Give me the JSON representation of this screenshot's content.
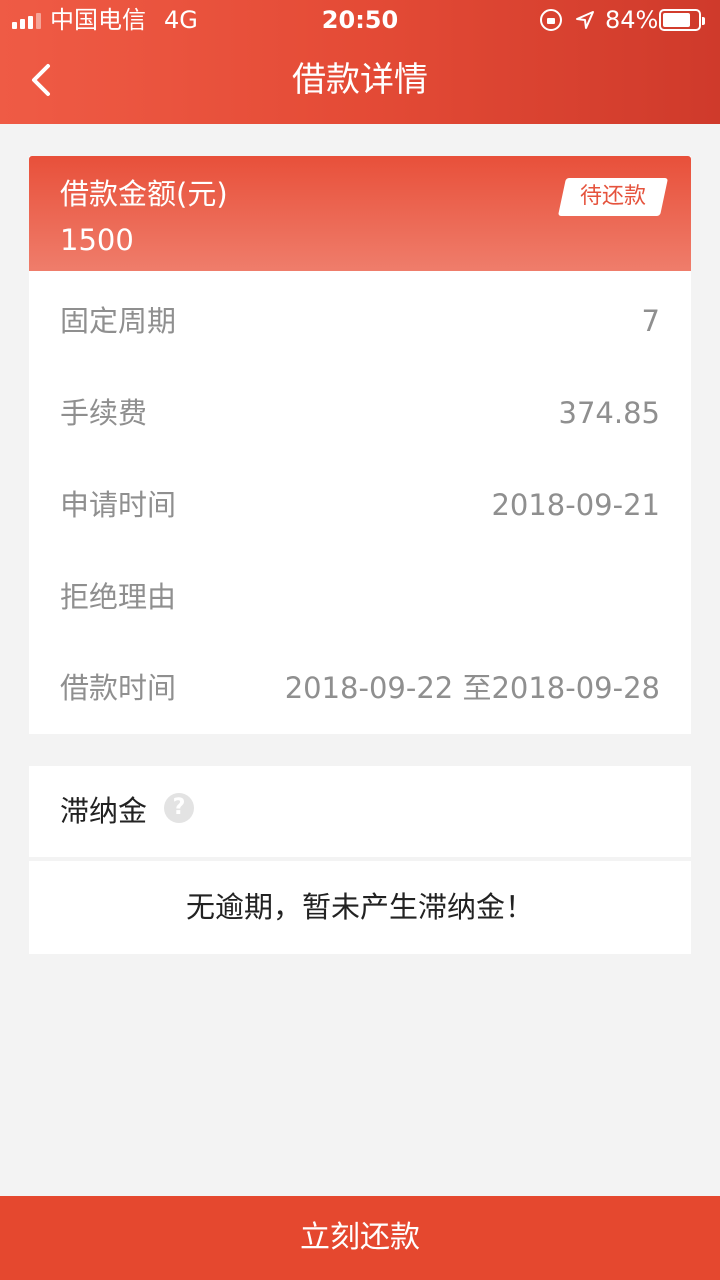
{
  "status_bar": {
    "carrier": "中国电信",
    "network": "4G",
    "time": "20:50",
    "battery": "84%",
    "battery_level": 0.84
  },
  "header": {
    "title": "借款详情",
    "background_color": "#e44b36"
  },
  "loan": {
    "amount_label": "借款金额(元)",
    "amount_value": "1500",
    "status_badge": "待还款",
    "rows": [
      {
        "key": "固定周期",
        "value": "7"
      },
      {
        "key": "手续费",
        "value": "374.85"
      },
      {
        "key": "申请时间",
        "value": "2018-09-21"
      },
      {
        "key": "拒绝理由",
        "value": ""
      },
      {
        "key": "借款时间",
        "value": "2018-09-22 至2018-09-28"
      }
    ]
  },
  "late_fee": {
    "title": "滞纳金",
    "help_icon": "question-circle-icon",
    "message": "无逾期，暂未产生滞纳金！"
  },
  "footer": {
    "repay_label": "立刻还款",
    "button_color": "#e5482f"
  }
}
